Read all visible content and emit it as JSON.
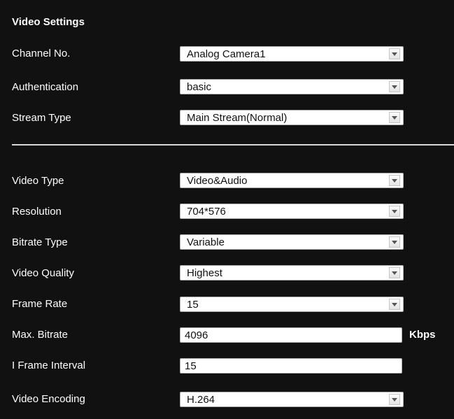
{
  "panel": {
    "title": "Video Settings"
  },
  "fields": {
    "channel_no": {
      "label": "Channel No.",
      "value": "Analog Camera1"
    },
    "authentication": {
      "label": "Authentication",
      "value": "basic"
    },
    "stream_type": {
      "label": "Stream Type",
      "value": "Main Stream(Normal)"
    },
    "video_type": {
      "label": "Video Type",
      "value": "Video&Audio"
    },
    "resolution": {
      "label": "Resolution",
      "value": "704*576"
    },
    "bitrate_type": {
      "label": "Bitrate Type",
      "value": "Variable"
    },
    "video_quality": {
      "label": "Video Quality",
      "value": "Highest"
    },
    "frame_rate": {
      "label": "Frame Rate",
      "value": "15"
    },
    "max_bitrate": {
      "label": "Max. Bitrate",
      "value": "4096",
      "unit": "Kbps"
    },
    "i_frame_interval": {
      "label": "I Frame Interval",
      "value": "15"
    },
    "video_encoding": {
      "label": "Video Encoding",
      "value": "H.264"
    }
  },
  "icons": {
    "dropdown_arrow": "chevron-down-icon"
  },
  "colors": {
    "background": "#111111",
    "text": "#ffffff",
    "field_background": "#ffffff",
    "field_text": "#111111",
    "divider": "#d8d8d8"
  }
}
